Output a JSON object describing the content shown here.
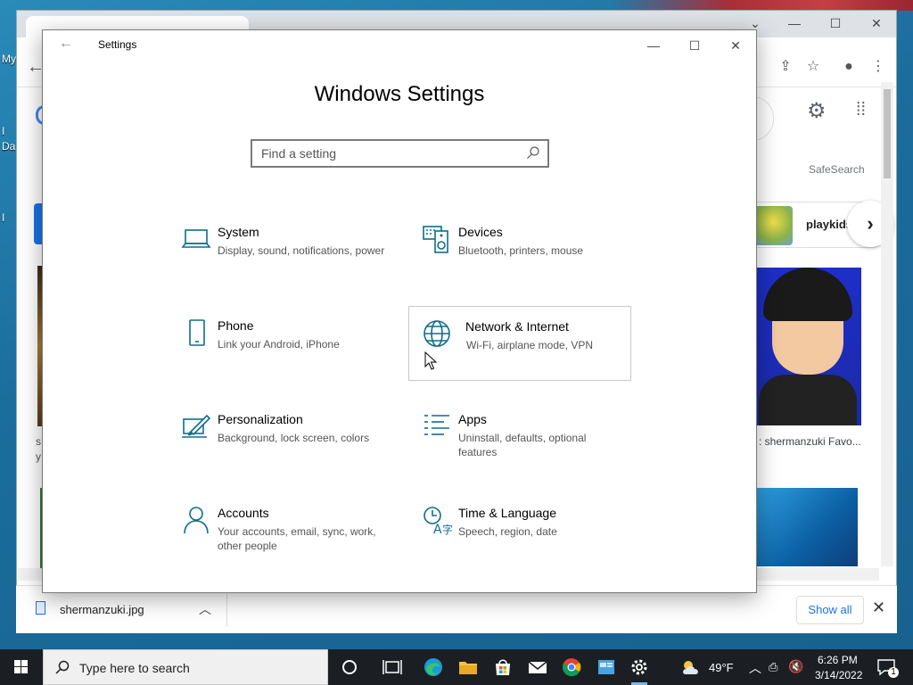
{
  "desktop": {
    "labels": [
      "My",
      "I",
      "Da",
      "I"
    ]
  },
  "browser": {
    "safesearch": "SafeSearch",
    "chip_label": "playkids",
    "image_caption": ": shermanzuki Favo...",
    "left_letters": [
      "s",
      "y"
    ],
    "download": {
      "filename": "shermanzuki.jpg",
      "show_all": "Show all"
    }
  },
  "settings": {
    "window_title": "Settings",
    "heading": "Windows Settings",
    "search_placeholder": "Find a setting",
    "tiles": [
      {
        "title": "System",
        "desc": "Display, sound, notifications, power",
        "icon": "laptop-icon"
      },
      {
        "title": "Devices",
        "desc": "Bluetooth, printers, mouse",
        "icon": "keyboard-speaker-icon"
      },
      {
        "title": "Phone",
        "desc": "Link your Android, iPhone",
        "icon": "phone-icon"
      },
      {
        "title": "Network & Internet",
        "desc": "Wi-Fi, airplane mode, VPN",
        "icon": "globe-icon"
      },
      {
        "title": "Personalization",
        "desc": "Background, lock screen, colors",
        "icon": "paintbrush-icon"
      },
      {
        "title": "Apps",
        "desc": "Uninstall, defaults, optional features",
        "icon": "apps-list-icon"
      },
      {
        "title": "Accounts",
        "desc": "Your accounts, email, sync, work, other people",
        "icon": "person-icon"
      },
      {
        "title": "Time & Language",
        "desc": "Speech, region, date",
        "icon": "clock-language-icon"
      }
    ],
    "accent_color": "#0e6e8a"
  },
  "taskbar": {
    "search_placeholder": "Type here to search",
    "weather": "49°F",
    "time": "6:26 PM",
    "date": "3/14/2022",
    "notification_count": "1"
  }
}
